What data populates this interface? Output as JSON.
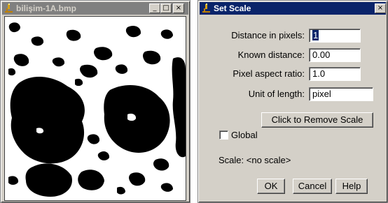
{
  "image_window": {
    "title": "bilişim-1A.bmp",
    "controls": {
      "minimize": "_",
      "maximize": "□",
      "close": "×"
    }
  },
  "dialog": {
    "title": "Set Scale",
    "close": "×",
    "fields": {
      "distance_label": "Distance in pixels:",
      "distance_value": "1",
      "known_label": "Known distance:",
      "known_value": "0.00",
      "aspect_label": "Pixel aspect ratio:",
      "aspect_value": "1.0",
      "unit_label": "Unit of length:",
      "unit_value": "pixel"
    },
    "remove_scale_button": "Click to Remove Scale",
    "global_label": "Global",
    "global_checked": false,
    "scale_status": "Scale: <no scale>",
    "ok_button": "OK",
    "cancel_button": "Cancel",
    "help_button": "Help"
  },
  "icons": {
    "app": "microscope-icon"
  },
  "colors": {
    "active_title": "#0a246a",
    "inactive_title": "#808080",
    "face": "#d4d0c8"
  }
}
